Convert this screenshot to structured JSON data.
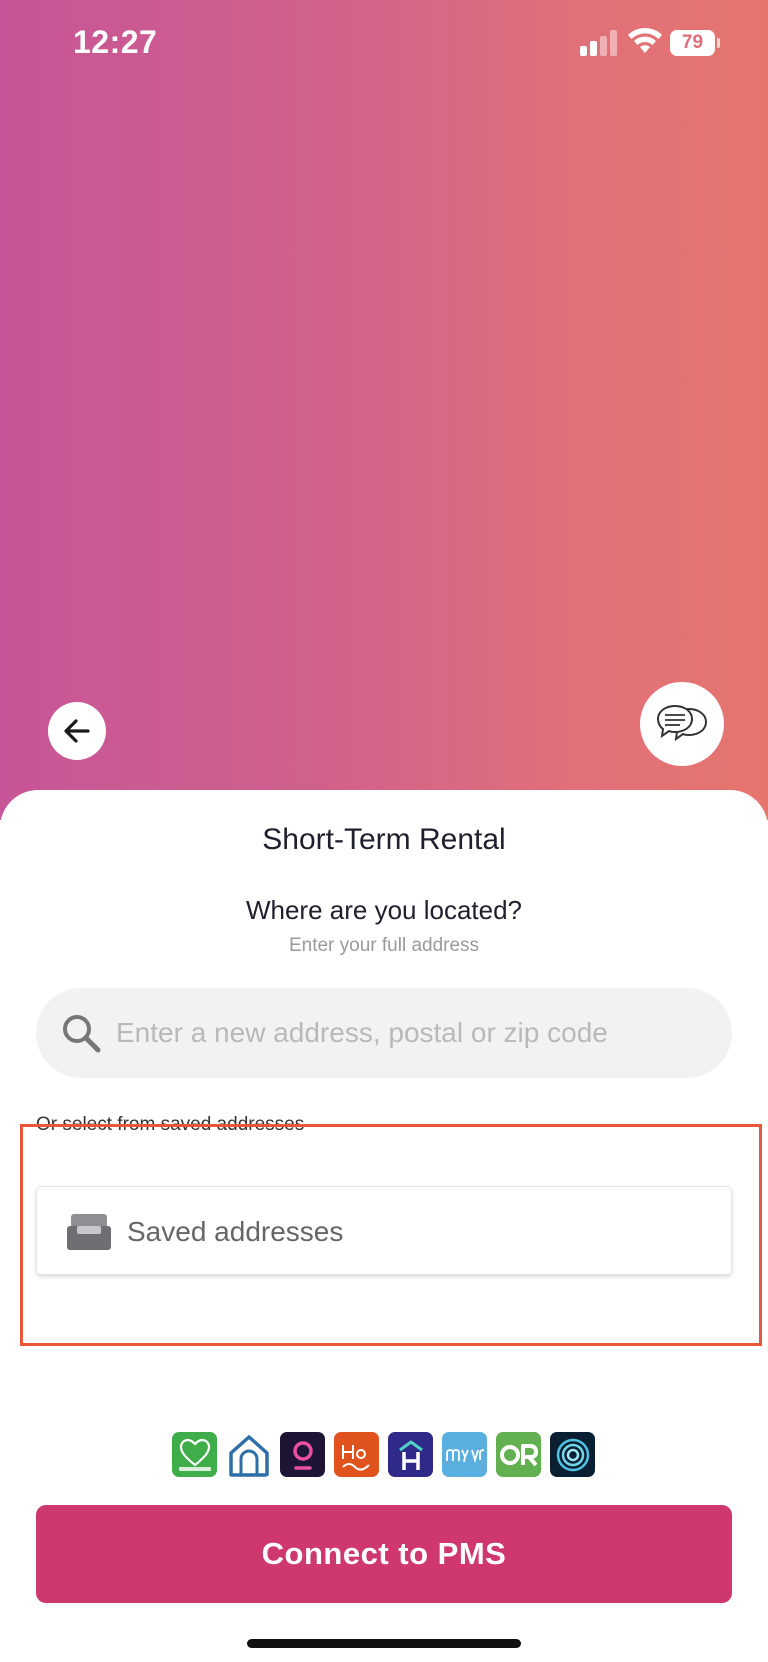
{
  "status_bar": {
    "time": "12:27",
    "battery_level": "79",
    "icons": [
      "signal-icon",
      "wifi-icon",
      "battery-icon"
    ]
  },
  "header": {
    "back_icon": "arrow-left-icon",
    "chat_icon": "chat-bubbles-icon"
  },
  "sheet": {
    "title": "Short-Term Rental",
    "question": "Where are you located?",
    "hint": "Enter your full address",
    "search": {
      "placeholder": "Enter a new address, postal or zip code",
      "value": ""
    },
    "saved_caption": "Or select from saved addresses",
    "saved_dropdown_label": "Saved addresses",
    "pms_logos": [
      {
        "name": "FantasticStay",
        "color": "#3fae4a"
      },
      {
        "name": "house-outline",
        "color": "#2d6fa8"
      },
      {
        "name": "pin-logo",
        "color": "#1e1433"
      },
      {
        "name": "Hostaway",
        "color": "#e0531f"
      },
      {
        "name": "H-logo",
        "color": "#2f2a8a"
      },
      {
        "name": "my-vr",
        "color": "#5aaee0"
      },
      {
        "name": "OR",
        "color": "#62b04f"
      },
      {
        "name": "circle-logo",
        "color": "#0b1f33"
      }
    ],
    "connect_button_label": "Connect to PMS"
  },
  "colors": {
    "gradient_start": "#c75597",
    "gradient_end": "#e6756e",
    "primary_button": "#cf386e",
    "highlight": "#e8573a"
  }
}
